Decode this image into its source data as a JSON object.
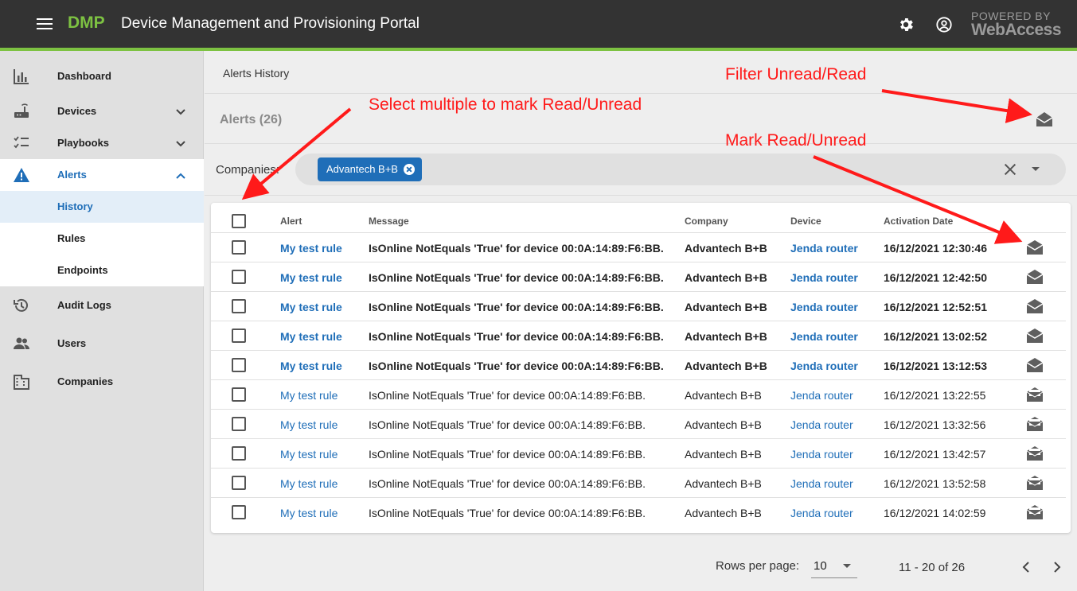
{
  "header": {
    "brand": "DMP",
    "title": "Device Management and Provisioning Portal",
    "powered_by": "POWERED BY",
    "powered_brand": "WebAccess",
    "settings_icon": "gear-icon",
    "account_icon": "account-circle-icon"
  },
  "sidebar": {
    "items": [
      {
        "label": "Dashboard",
        "icon": "bar-chart-icon"
      },
      {
        "label": "Devices",
        "icon": "router-icon"
      },
      {
        "label": "Playbooks",
        "icon": "checklist-icon"
      },
      {
        "label": "Alerts",
        "icon": "warning-icon"
      },
      {
        "label": "History"
      },
      {
        "label": "Rules"
      },
      {
        "label": "Endpoints"
      },
      {
        "label": "Audit Logs",
        "icon": "history-icon"
      },
      {
        "label": "Users",
        "icon": "people-icon"
      },
      {
        "label": "Companies",
        "icon": "building-icon"
      }
    ]
  },
  "breadcrumb": "Alerts History",
  "alerts": {
    "title": "Alerts (26)"
  },
  "companies": {
    "label": "Companies:",
    "chip": "Advantech B+B"
  },
  "table": {
    "columns": [
      "Alert",
      "Message",
      "Company",
      "Device",
      "Activation Date"
    ],
    "rows": [
      {
        "alert": "My test rule",
        "message": "IsOnline NotEquals 'True' for device 00:0A:14:89:F6:BB.",
        "company": "Advantech B+B",
        "device": "Jenda router",
        "date": "16/12/2021 12:30:46",
        "read": false
      },
      {
        "alert": "My test rule",
        "message": "IsOnline NotEquals 'True' for device 00:0A:14:89:F6:BB.",
        "company": "Advantech B+B",
        "device": "Jenda router",
        "date": "16/12/2021 12:42:50",
        "read": false
      },
      {
        "alert": "My test rule",
        "message": "IsOnline NotEquals 'True' for device 00:0A:14:89:F6:BB.",
        "company": "Advantech B+B",
        "device": "Jenda router",
        "date": "16/12/2021 12:52:51",
        "read": false
      },
      {
        "alert": "My test rule",
        "message": "IsOnline NotEquals 'True' for device 00:0A:14:89:F6:BB.",
        "company": "Advantech B+B",
        "device": "Jenda router",
        "date": "16/12/2021 13:02:52",
        "read": false
      },
      {
        "alert": "My test rule",
        "message": "IsOnline NotEquals 'True' for device 00:0A:14:89:F6:BB.",
        "company": "Advantech B+B",
        "device": "Jenda router",
        "date": "16/12/2021 13:12:53",
        "read": false
      },
      {
        "alert": "My test rule",
        "message": "IsOnline NotEquals 'True' for device 00:0A:14:89:F6:BB.",
        "company": "Advantech B+B",
        "device": "Jenda router",
        "date": "16/12/2021 13:22:55",
        "read": true
      },
      {
        "alert": "My test rule",
        "message": "IsOnline NotEquals 'True' for device 00:0A:14:89:F6:BB.",
        "company": "Advantech B+B",
        "device": "Jenda router",
        "date": "16/12/2021 13:32:56",
        "read": true
      },
      {
        "alert": "My test rule",
        "message": "IsOnline NotEquals 'True' for device 00:0A:14:89:F6:BB.",
        "company": "Advantech B+B",
        "device": "Jenda router",
        "date": "16/12/2021 13:42:57",
        "read": true
      },
      {
        "alert": "My test rule",
        "message": "IsOnline NotEquals 'True' for device 00:0A:14:89:F6:BB.",
        "company": "Advantech B+B",
        "device": "Jenda router",
        "date": "16/12/2021 13:52:58",
        "read": true
      },
      {
        "alert": "My test rule",
        "message": "IsOnline NotEquals 'True' for device 00:0A:14:89:F6:BB.",
        "company": "Advantech B+B",
        "device": "Jenda router",
        "date": "16/12/2021 14:02:59",
        "read": true
      }
    ]
  },
  "pagination": {
    "rows_per_page_label": "Rows per page:",
    "rows_per_page": "10",
    "range": "11 - 20 of 26"
  },
  "annotations": {
    "filter": "Filter Unread/Read",
    "select_multiple": "Select multiple to mark Read/Unread",
    "mark": "Mark Read/Unread",
    "color": "#ff1a1a"
  },
  "colors": {
    "topbar": "#333333",
    "accent": "#7dc242",
    "link": "#1f6eb8"
  }
}
